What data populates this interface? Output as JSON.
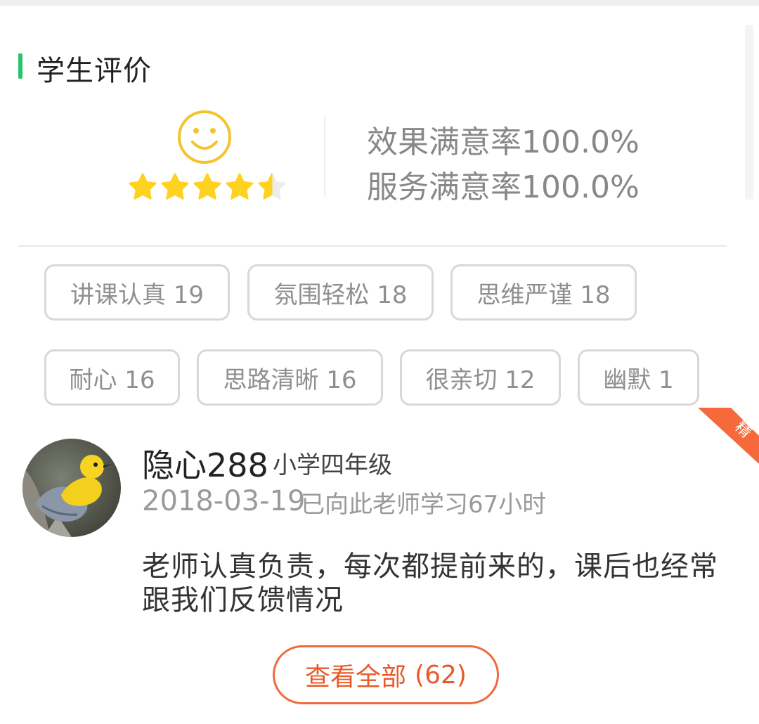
{
  "section": {
    "title": "学生评价"
  },
  "rating": {
    "stars": 4.5,
    "effect_rate": "效果满意率100.0%",
    "service_rate": "服务满意率100.0%"
  },
  "tags": [
    {
      "label": "讲课认真 19"
    },
    {
      "label": "氛围轻松 18"
    },
    {
      "label": "思维严谨 18"
    },
    {
      "label": "耐心 16"
    },
    {
      "label": "思路清晰 16"
    },
    {
      "label": "很亲切 12"
    },
    {
      "label": "幽默 1"
    }
  ],
  "review": {
    "badge": "精",
    "username": "隐心288",
    "grade": "小学四年级",
    "date": "2018-03-19",
    "study_hours": "已向此老师学习67小时",
    "comment": "老师认真负责，每次都提前来的，课后也经常跟我们反馈情况"
  },
  "view_all": {
    "label": "查看全部",
    "count": "(62)"
  },
  "colors": {
    "accent_green": "#2bc46e",
    "star_yellow": "#ffd21f",
    "badge_orange": "#f5693a"
  }
}
